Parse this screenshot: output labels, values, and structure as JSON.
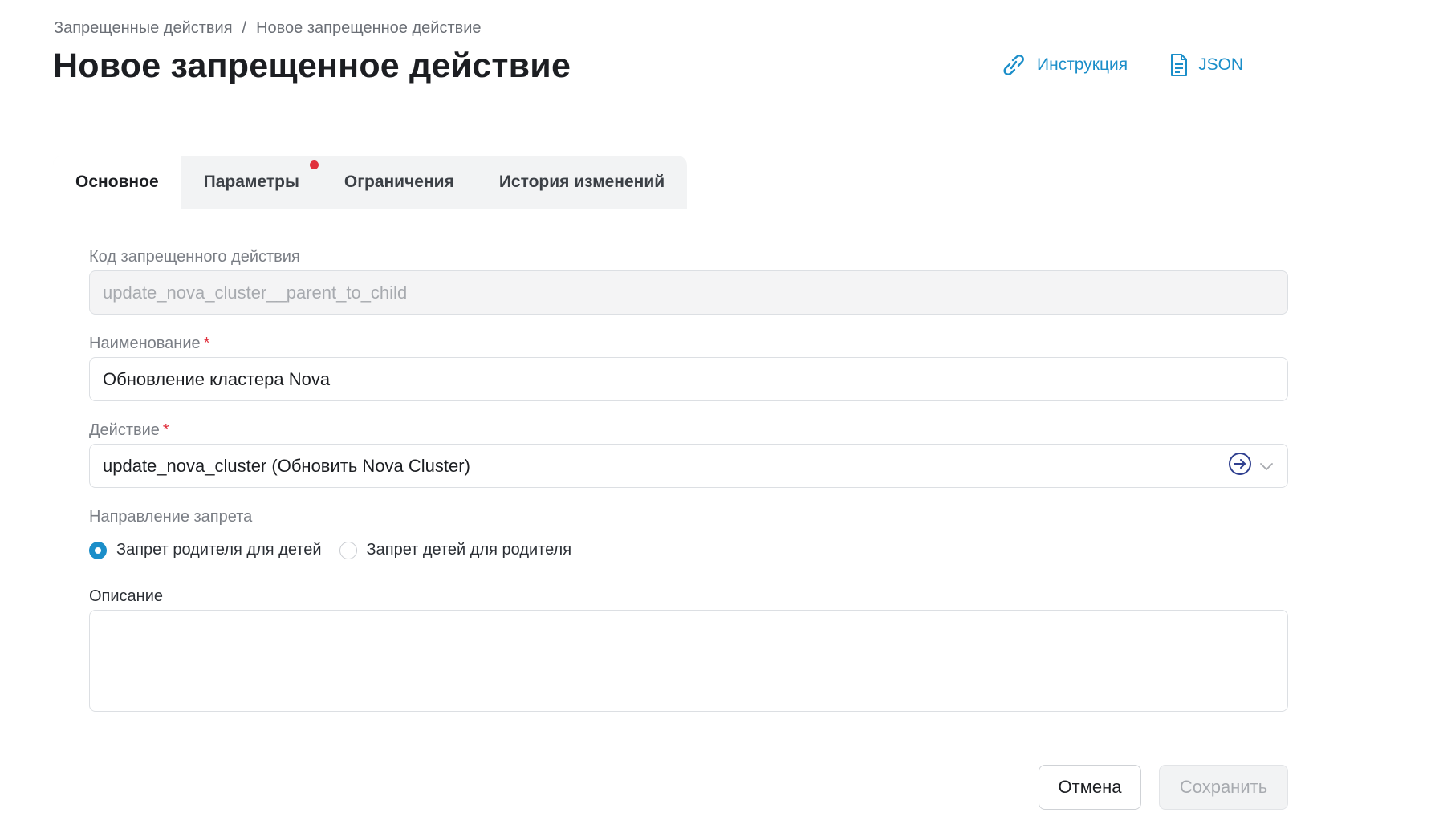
{
  "breadcrumb": {
    "parent": "Запрещенные действия",
    "separator": "/",
    "current": "Новое запрещенное действие"
  },
  "page": {
    "title": "Новое запрещенное действие"
  },
  "header_links": {
    "instruction": {
      "label": "Инструкция",
      "icon": "link-icon"
    },
    "json": {
      "label": "JSON",
      "icon": "document-icon"
    }
  },
  "tabs": [
    {
      "label": "Основное",
      "active": true
    },
    {
      "label": "Параметры",
      "has_indicator": true
    },
    {
      "label": "Ограничения"
    },
    {
      "label": "История изменений"
    }
  ],
  "form": {
    "code": {
      "label": "Код запрещенного действия",
      "value": "update_nova_cluster__parent_to_child",
      "disabled": true
    },
    "name": {
      "label": "Наименование",
      "required_mark": "*",
      "value": "Обновление кластера Nova"
    },
    "action": {
      "label": "Действие",
      "required_mark": "*",
      "value": "update_nova_cluster (Обновить Nova Cluster)"
    },
    "direction": {
      "label": "Направление запрета",
      "options": [
        {
          "label": "Запрет родителя для детей",
          "checked": true
        },
        {
          "label": "Запрет детей для родителя",
          "checked": false
        }
      ]
    },
    "description": {
      "label": "Описание",
      "value": ""
    }
  },
  "buttons": {
    "cancel": "Отмена",
    "save": "Сохранить"
  },
  "colors": {
    "accent": "#1b8ec9",
    "required": "#e0303d",
    "tab_background": "#f2f3f4"
  }
}
